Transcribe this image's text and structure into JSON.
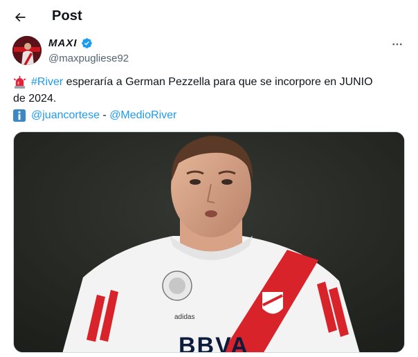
{
  "header": {
    "title": "Post",
    "back_icon": "arrow-left-icon"
  },
  "author": {
    "display_name": "MAXI",
    "handle": "@maxpugliese92",
    "verified_icon": "verified-badge-icon",
    "more_icon": "more-horizontal-icon"
  },
  "tweet": {
    "line1": {
      "emoji": "rotating-light-icon",
      "hashtag": "#River",
      "text": " esperaría a German Pezzella para que se incorpore en JUNIO"
    },
    "line2": {
      "text": "de 2024."
    },
    "line3": {
      "emoji": "information-icon",
      "mention1": "@juancortese",
      "separator": " - ",
      "mention2": "@MedioRiver"
    }
  },
  "media": {
    "description_icon": "player-photo",
    "jersey_text": "BBVA",
    "adidas_text": "adidas"
  },
  "colors": {
    "link": "#1d9bf0",
    "verified": "#1d9bf0",
    "secondary": "#536471",
    "jersey_sash": "#d8232a"
  }
}
